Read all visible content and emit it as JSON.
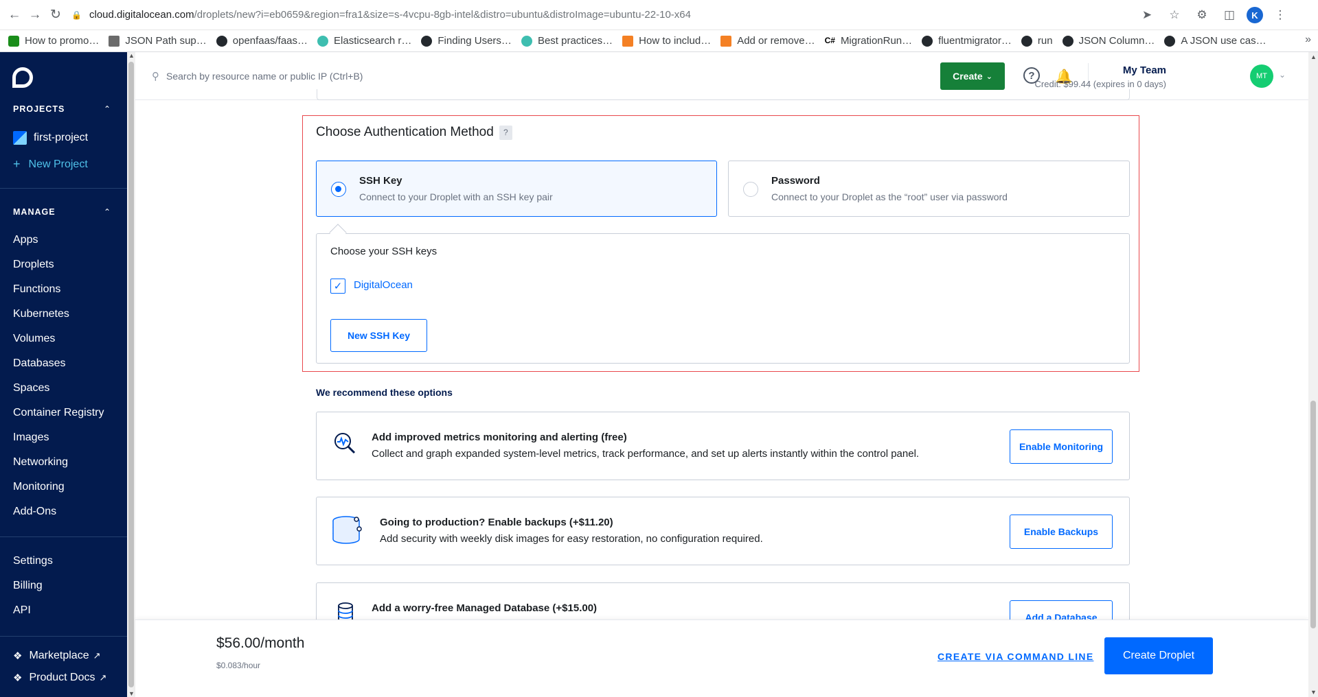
{
  "browser": {
    "url_host": "cloud.digitalocean.com",
    "url_path": "/droplets/new?i=eb0659&region=fra1&size=s-4vcpu-8gb-intel&distro=ubuntu&distroImage=ubuntu-22-10-x64",
    "profile_initial": "K",
    "bookmarks": [
      "How to promo…",
      "JSON Path sup…",
      "openfaas/faas…",
      "Elasticsearch r…",
      "Finding Users…",
      "Best practices…",
      "How to includ…",
      "Add or remove…",
      "MigrationRun…",
      "fluentmigrator…",
      "run",
      "JSON Column…",
      "A JSON use cas…"
    ],
    "bookmark_cs_prefix": "C#"
  },
  "sidebar": {
    "projects_header": "PROJECTS",
    "project_name": "first-project",
    "new_project": "New Project",
    "manage_header": "MANAGE",
    "manage_items": [
      "Apps",
      "Droplets",
      "Functions",
      "Kubernetes",
      "Volumes",
      "Databases",
      "Spaces",
      "Container Registry",
      "Images",
      "Networking",
      "Monitoring",
      "Add-Ons"
    ],
    "account_items": [
      "Settings",
      "Billing",
      "API"
    ],
    "marketplace": "Marketplace",
    "product_docs": "Product Docs"
  },
  "header": {
    "search_placeholder": "Search by resource name or public IP (Ctrl+B)",
    "create_label": "Create",
    "team_name": "My Team",
    "credit": "Credit: $99.44 (expires in 0 days)",
    "avatar_initials": "MT"
  },
  "auth": {
    "title": "Choose Authentication Method",
    "help": "?",
    "ssh_title": "SSH Key",
    "ssh_desc": "Connect to your Droplet with an SSH key pair",
    "ssh_selected": true,
    "pwd_title": "Password",
    "pwd_desc": "Connect to your Droplet as the “root” user via password",
    "keys_title": "Choose your SSH keys",
    "key_name": "DigitalOcean",
    "key_checked": true,
    "new_key_label": "New SSH Key"
  },
  "recommend": {
    "title": "We recommend these options",
    "cards": [
      {
        "title": "Add improved metrics monitoring and alerting (free)",
        "desc": "Collect and graph expanded system-level metrics, track performance, and set up alerts instantly within the control panel.",
        "button": "Enable Monitoring",
        "icon": "monitoring-icon"
      },
      {
        "title": "Going to production? Enable backups (+$11.20)",
        "desc": "Add security with weekly disk images for easy restoration, no configuration required.",
        "button": "Enable Backups",
        "icon": "backups-icon"
      },
      {
        "title": "Add a worry-free Managed Database (+$15.00)",
        "desc": "",
        "button": "Add a Database",
        "icon": "database-icon"
      }
    ]
  },
  "footer": {
    "price": "$56.00/month",
    "price_hour": "$0.083/hour",
    "cli_link": "CREATE VIA COMMAND LINE",
    "create_label": "Create Droplet"
  },
  "colors": {
    "sidebar_bg": "#031b4e",
    "primary_blue": "#0069ff",
    "create_green": "#168039",
    "highlight_red": "#e9474b"
  }
}
